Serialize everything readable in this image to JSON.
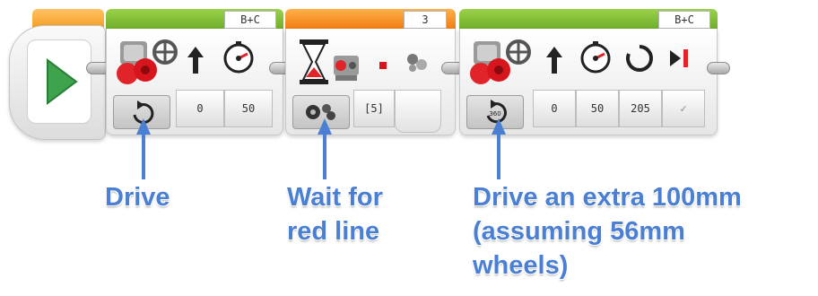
{
  "start_block": {
    "icon": "play-icon",
    "accent": "#f7a21b"
  },
  "block1": {
    "type": "move-steering",
    "ports": "B+C",
    "mode_icon": "rotate-on-icon",
    "params": [
      "0",
      "50"
    ],
    "icons": [
      "steering-motor-icon",
      "steering-arrow-icon",
      "power-gauge-icon"
    ]
  },
  "block2": {
    "type": "wait",
    "port": "3",
    "mode_icon": "color-sensor-mode-icon",
    "params": [
      "[5]"
    ],
    "icons": [
      "hourglass-icon",
      "color-sensor-icon",
      "red-dot-icon",
      "color-circles-icon"
    ]
  },
  "block3": {
    "type": "move-steering",
    "ports": "B+C",
    "mode_icon": "rotate-degrees-icon",
    "params": [
      "0",
      "50",
      "205",
      "✓"
    ],
    "icons": [
      "steering-motor-icon",
      "steering-arrow-icon",
      "power-gauge-icon",
      "degrees-icon",
      "brake-icon"
    ]
  },
  "captions": {
    "drive": "Drive",
    "wait_line1": "Wait for",
    "wait_line2": "red line",
    "extra_line1": "Drive an extra 100mm",
    "extra_line2": "(assuming 56mm",
    "extra_line3": "wheels)"
  },
  "colors": {
    "block_green": "#7dbf34",
    "block_orange": "#f5901e",
    "arrow_blue": "#4a7fd4",
    "play_green": "#3fa34d"
  }
}
